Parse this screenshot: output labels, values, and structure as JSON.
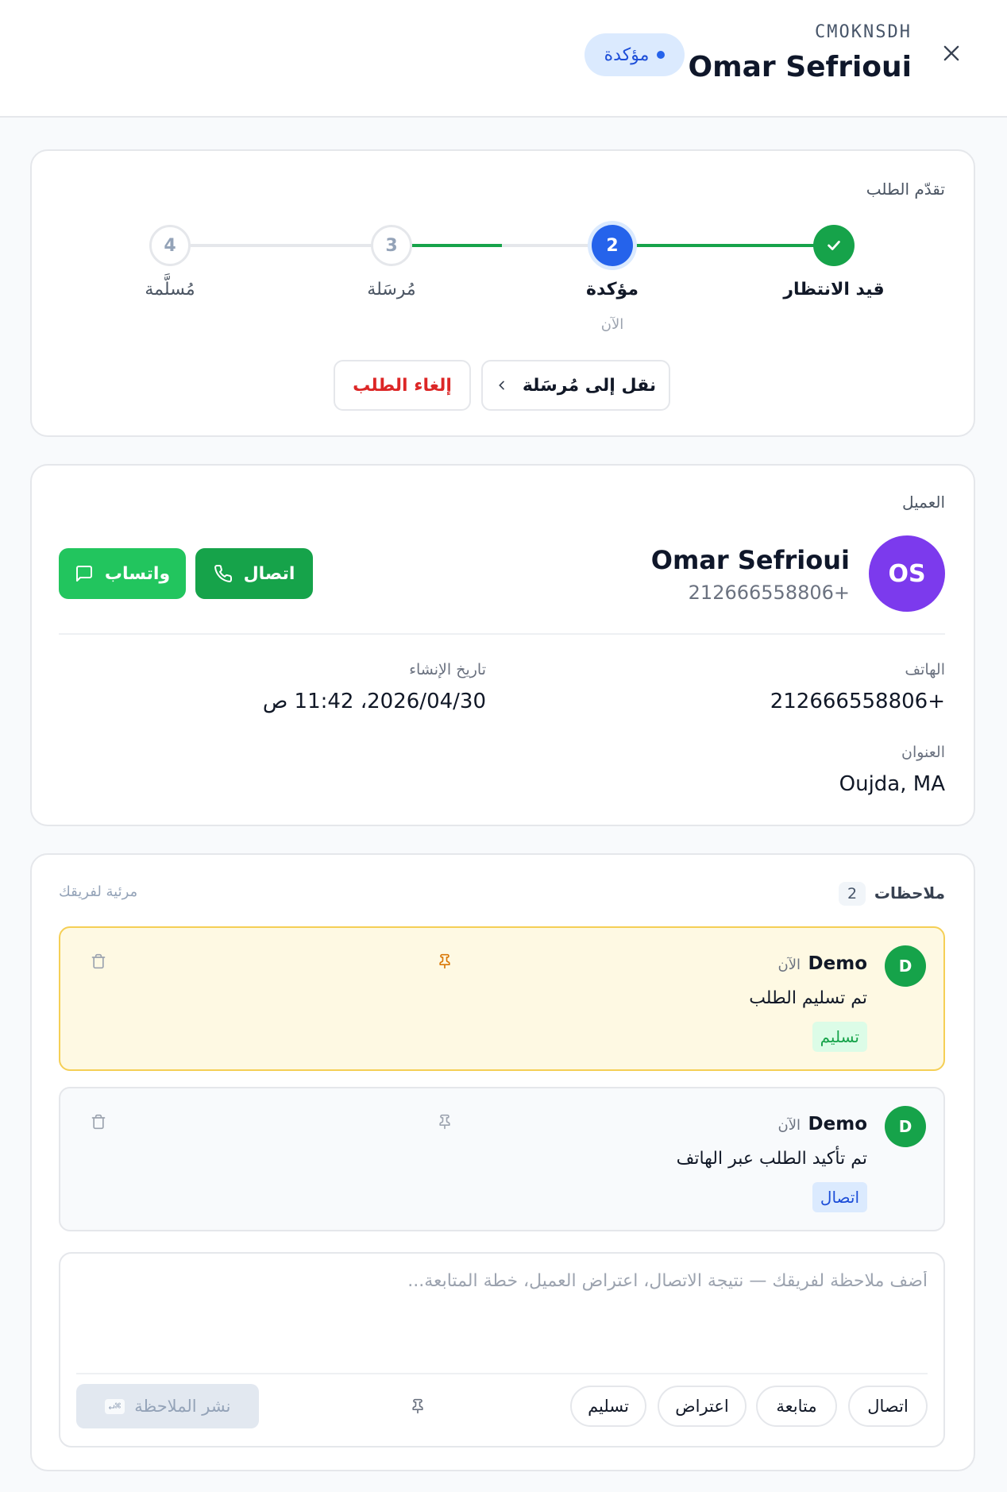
{
  "header": {
    "order_code": "CMOKNSDH",
    "customer_name": "Omar Sefrioui",
    "status_label": "مؤكدة",
    "close_icon": "close-icon"
  },
  "progress": {
    "section_label": "تقدّم الطلب",
    "steps": [
      {
        "number": "✓",
        "label": "قيد الانتظار",
        "state": "done"
      },
      {
        "number": "2",
        "label": "مؤكدة",
        "sub": "الآن",
        "state": "current"
      },
      {
        "number": "3",
        "label": "مُرسَلة",
        "state": "pending"
      },
      {
        "number": "4",
        "label": "مُسلَّمة",
        "state": "pending"
      }
    ],
    "move_button": "نقل إلى مُرسَلة",
    "cancel_button": "إلغاء الطلب"
  },
  "customer": {
    "section_label": "العميل",
    "initials": "OS",
    "name": "Omar Sefrioui",
    "phone": "212666558806+",
    "call_button": "اتصال",
    "whatsapp_button": "واتساب",
    "phone_label": "الهاتف",
    "phone_value": "212666558806+",
    "created_label": "تاريخ الإنشاء",
    "created_value": "2026/04/30، 11:42 ص",
    "address_label": "العنوان",
    "address_value": "Oujda, MA"
  },
  "notes": {
    "section_label": "ملاحظات",
    "count": "2",
    "visibility": "مرئية لفريقك",
    "items": [
      {
        "initial": "D",
        "author": "Demo",
        "time": "الآن",
        "text": "تم تسليم الطلب",
        "tag": "تسليم",
        "pinned": true
      },
      {
        "initial": "D",
        "author": "Demo",
        "time": "الآن",
        "text": "تم تأكيد الطلب عبر الهاتف",
        "tag": "اتصال",
        "pinned": false
      }
    ],
    "composer": {
      "placeholder": "أضف ملاحظة لفريقك — نتيجة الاتصال، اعتراض العميل، خطة المتابعة...",
      "chips": [
        "اتصال",
        "متابعة",
        "اعتراض",
        "تسليم"
      ],
      "post_button": "نشر الملاحظة",
      "shortcut": "⌘↵"
    }
  },
  "colors": {
    "accent_blue": "#2563eb",
    "success_green": "#16a34a",
    "whatsapp_green": "#22c55e",
    "danger_red": "#dc2626",
    "avatar_purple": "#7c3aed",
    "pinned_bg": "#fef9e3",
    "pinned_border": "#f5cf55"
  }
}
